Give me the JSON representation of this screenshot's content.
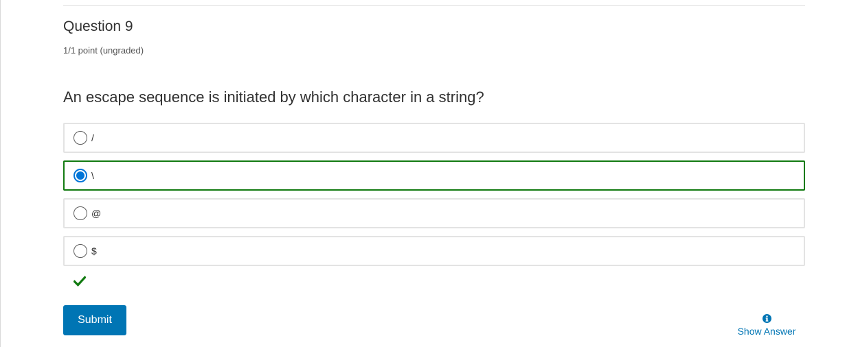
{
  "question": {
    "title": "Question 9",
    "points": "1/1 point (ungraded)",
    "text": "An escape sequence is initiated by which character in a string?"
  },
  "options": [
    {
      "label": "/",
      "selected": false
    },
    {
      "label": "\\",
      "selected": true
    },
    {
      "label": "@",
      "selected": false
    },
    {
      "label": "$",
      "selected": false
    }
  ],
  "status": {
    "icon": "checkmark-icon",
    "color": "#117a10"
  },
  "actions": {
    "submit_label": "Submit",
    "show_answer_label": "Show Answer",
    "show_answer_icon": "info-icon"
  },
  "colors": {
    "accent": "#0075b4",
    "correct_border": "#117a10",
    "radio_checked": "#0075d8"
  }
}
